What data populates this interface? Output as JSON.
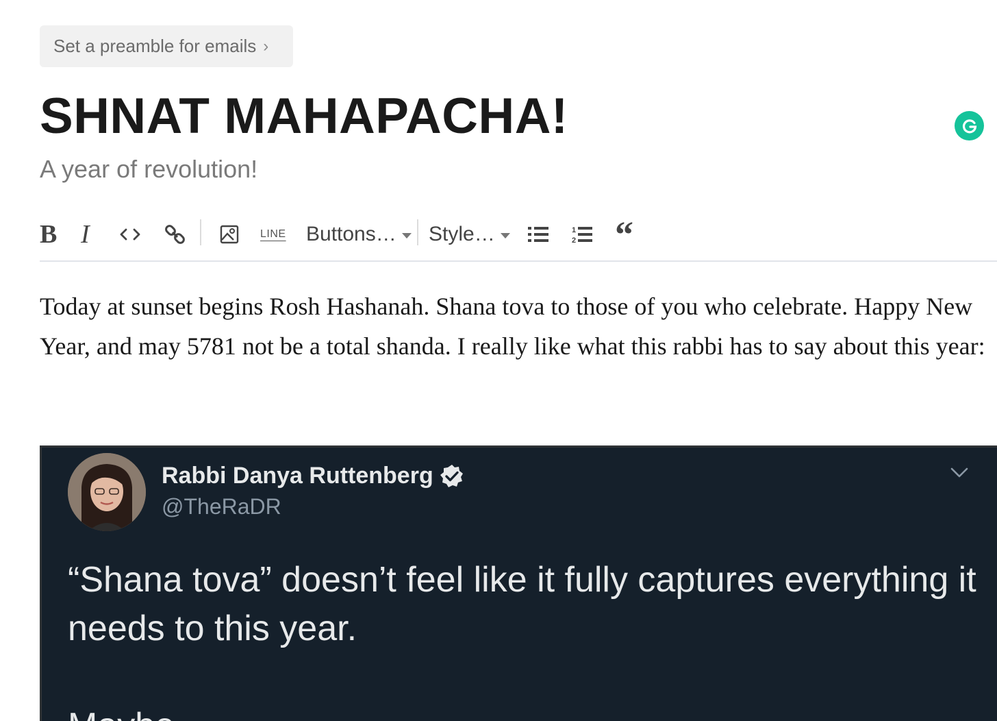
{
  "header": {
    "preamble_label": "Set a preamble for emails",
    "title": "SHNAT MAHAPACHA!",
    "subtitle": "A year of revolution!"
  },
  "toolbar": {
    "bold_label": "B",
    "italic_label": "I",
    "line_label": "LINE",
    "buttons_label": "Buttons…",
    "style_label": "Style…"
  },
  "body": {
    "paragraph": "Today at sunset begins Rosh Hashanah. Shana tova to those of you who celebrate. Happy New Year, and may 5781 not be a total shanda. I really like what this rabbi has to say about this year:"
  },
  "tweet": {
    "name": "Rabbi Danya Ruttenberg",
    "handle": "@TheRaDR",
    "text_1": "“Shana tova” doesn’t feel like it fully captures everything it needs to this year.",
    "text_2": "Maybe"
  },
  "colors": {
    "tweet_bg": "#15202b",
    "grammarly": "#15c39a"
  }
}
